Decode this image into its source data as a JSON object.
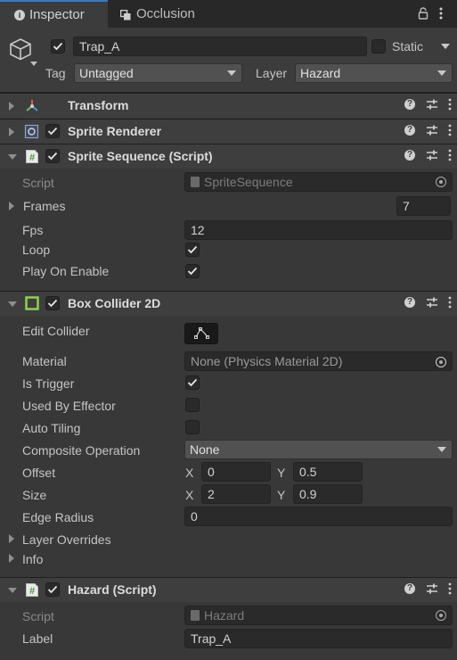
{
  "tabs": [
    {
      "label": "Inspector",
      "icon": "info-icon",
      "active": true
    },
    {
      "label": "Occlusion",
      "icon": "occlusion-icon",
      "active": false
    }
  ],
  "header": {
    "object_name": "Trap_A",
    "active": true,
    "static_label": "Static",
    "static": false,
    "tag_label": "Tag",
    "tag_value": "Untagged",
    "layer_label": "Layer",
    "layer_value": "Hazard"
  },
  "components": {
    "transform": {
      "title": "Transform"
    },
    "sprite_renderer": {
      "title": "Sprite Renderer",
      "enabled": true
    },
    "sprite_sequence": {
      "title": "Sprite Sequence (Script)",
      "enabled": true,
      "script_label": "Script",
      "script_value": "SpriteSequence",
      "frames_label": "Frames",
      "frames_value": "7",
      "fps_label": "Fps",
      "fps_value": "12",
      "loop_label": "Loop",
      "loop": true,
      "play_on_enable_label": "Play On Enable",
      "play_on_enable": true
    },
    "box_collider": {
      "title": "Box Collider 2D",
      "enabled": true,
      "edit_collider_label": "Edit Collider",
      "material_label": "Material",
      "material_value": "None (Physics Material 2D)",
      "is_trigger_label": "Is Trigger",
      "is_trigger": true,
      "used_by_effector_label": "Used By Effector",
      "used_by_effector": false,
      "auto_tiling_label": "Auto Tiling",
      "auto_tiling": false,
      "composite_label": "Composite Operation",
      "composite_value": "None",
      "offset_label": "Offset",
      "offset_x": "0",
      "offset_y": "0.5",
      "size_label": "Size",
      "size_x": "2",
      "size_y": "0.9",
      "x_label": "X",
      "y_label": "Y",
      "edge_radius_label": "Edge Radius",
      "edge_radius_value": "0",
      "layer_overrides_label": "Layer Overrides",
      "info_label": "Info"
    },
    "hazard": {
      "title": "Hazard (Script)",
      "enabled": true,
      "script_label": "Script",
      "script_value": "Hazard",
      "label_label": "Label",
      "label_value": "Trap_A"
    }
  },
  "colors": {
    "background": "#383838",
    "tab_accent": "#3a79bb",
    "collider_icon": "#8fd14f",
    "script_icon": "#9fd86f",
    "transform_red": "#e05a4f",
    "transform_green": "#6fbf4f",
    "transform_blue": "#4f8fe0"
  }
}
